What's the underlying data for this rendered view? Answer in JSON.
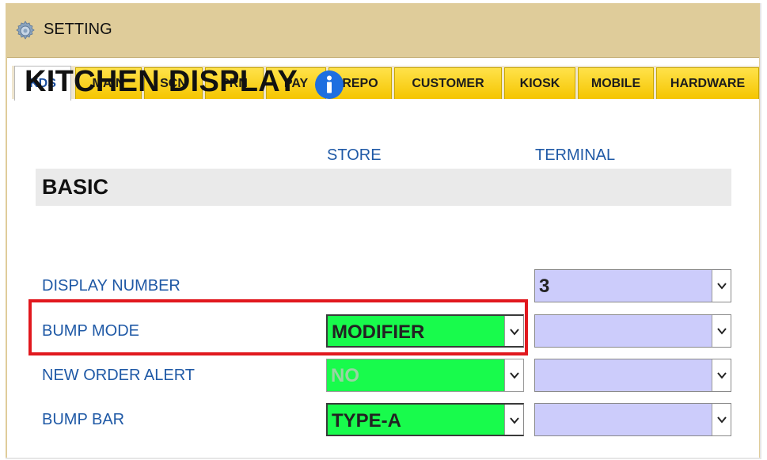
{
  "window": {
    "title": "SETTING",
    "title_icon": "gear-icon"
  },
  "tabs": [
    {
      "label": "KDS",
      "active": true
    },
    {
      "label": "MAIN"
    },
    {
      "label": "SCN"
    },
    {
      "label": "PRN"
    },
    {
      "label": "PAY"
    },
    {
      "label": "REPO"
    },
    {
      "label": "CUSTOMER"
    },
    {
      "label": "KIOSK"
    },
    {
      "label": "MOBILE"
    },
    {
      "label": "HARDWARE"
    }
  ],
  "page": {
    "heading": "KITCHEN DISPLAY",
    "heading_icon": "info-icon"
  },
  "columns": {
    "store": "STORE",
    "terminal": "TERMINAL"
  },
  "section": {
    "label": "BASIC"
  },
  "rows": [
    {
      "label": "DISPLAY NUMBER",
      "store": null,
      "terminal": "3"
    },
    {
      "label": "BUMP MODE",
      "store": "MODIFIER",
      "terminal": ""
    },
    {
      "label": "NEW ORDER ALERT",
      "store": "NO",
      "terminal": ""
    },
    {
      "label": "BUMP BAR",
      "store": "TYPE-A",
      "terminal": ""
    }
  ],
  "colors": {
    "title_bar": "#dfcc9a",
    "tab_gold": "#f5c500",
    "label_blue": "#1f59a6",
    "store_select": "#18fb4c",
    "terminal_select": "#ccccfb",
    "highlight": "#e1181e"
  }
}
